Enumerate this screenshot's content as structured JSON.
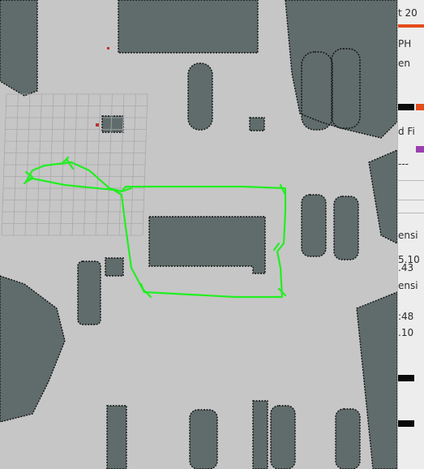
{
  "map": {
    "colors": {
      "free": "#c6c6c6",
      "occupied": "#5f6c6b",
      "grid": "#a9a9a9",
      "path": "#22ee22",
      "edge": "#111111"
    }
  },
  "side_panel": {
    "lines": [
      "t 20",
      "PH",
      "en",
      "d Fi",
      "---",
      "",
      "",
      "ensi",
      "5.10",
      ".43",
      "ensi",
      ":48",
      ".10"
    ],
    "swatch_colors": [
      "#e44c1c",
      "#9b3fb0"
    ]
  }
}
